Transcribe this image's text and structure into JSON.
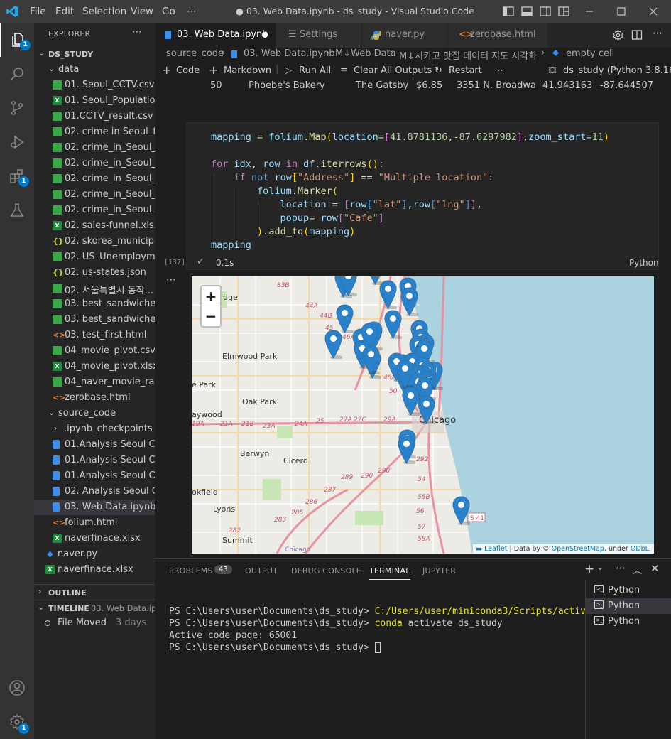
{
  "titlebar": {
    "menus": [
      "File",
      "Edit",
      "Selection",
      "View",
      "Go",
      "⋯"
    ],
    "title": "● 03. Web Data.ipynb - ds_study - Visual Studio Code"
  },
  "activity": {
    "explorer_badge": "1",
    "extensions_badge": "1",
    "settings_badge": "1"
  },
  "sidebar": {
    "header": "EXPLORER",
    "root": "DS_STUDY",
    "data_folder": "data",
    "data_files": [
      {
        "name": "01. Seoul_CCTV.csv",
        "type": "csv"
      },
      {
        "name": "01. Seoul_Populatio...",
        "type": "xlsx"
      },
      {
        "name": "01.CCTV_result.csv",
        "type": "csv"
      },
      {
        "name": "02. crime in Seoul_fi...",
        "type": "csv"
      },
      {
        "name": "02. crime_in_Seoul_1...",
        "type": "csv"
      },
      {
        "name": "02. crime_in_Seoul_fi...",
        "type": "csv"
      },
      {
        "name": "02. crime_in_Seoul_l...",
        "type": "csv"
      },
      {
        "name": "02. crime_in_Seoul_r...",
        "type": "csv"
      },
      {
        "name": "02. crime_in_Seoul.csv",
        "type": "csv"
      },
      {
        "name": "02. sales-funnel.xlsx",
        "type": "xlsx"
      },
      {
        "name": "02. skorea_municipa...",
        "type": "json"
      },
      {
        "name": "02. US_Unemploym...",
        "type": "csv"
      },
      {
        "name": "02. us-states.json",
        "type": "json"
      },
      {
        "name": "02. 서울특별시 동작...",
        "type": "csv"
      },
      {
        "name": "03. best_sandwiches...",
        "type": "csv"
      },
      {
        "name": "03. best_sandwiches...",
        "type": "csv"
      },
      {
        "name": "03. test_first.html",
        "type": "html"
      },
      {
        "name": "04_movie_pivot.csv",
        "type": "csv"
      },
      {
        "name": "04_movie_pivot.xlsx",
        "type": "xlsx"
      },
      {
        "name": "04_naver_movie_raw...",
        "type": "csv"
      },
      {
        "name": "zerobase.html",
        "type": "html"
      }
    ],
    "source_folder": "source_code",
    "source_files": [
      {
        "name": ".ipynb_checkpoints",
        "type": "folder"
      },
      {
        "name": "01.Analysis Seoul CC...",
        "type": "nb"
      },
      {
        "name": "01.Analysis Seoul CC...",
        "type": "nb"
      },
      {
        "name": "01.Analysis Seoul CC...",
        "type": "nb"
      },
      {
        "name": "02. Analysis Seoul Cr...",
        "type": "nb"
      },
      {
        "name": "03. Web Data.ipynb",
        "type": "nb"
      },
      {
        "name": "folium.html",
        "type": "html"
      },
      {
        "name": "naverfinace.xlsx",
        "type": "xlsx"
      }
    ],
    "root_files": [
      {
        "name": "naver.py",
        "type": "py"
      },
      {
        "name": "naverfinace.xlsx",
        "type": "xlsx"
      }
    ],
    "outline": "OUTLINE",
    "timeline": "TIMELINE",
    "timeline_file": "03. Web Data.ipy...",
    "timeline_event": "File Moved",
    "timeline_time": "3 days"
  },
  "tabs": [
    {
      "label": "03. Web Data.ipynb",
      "active": true
    },
    {
      "label": "Settings",
      "active": false
    },
    {
      "label": "naver.py",
      "active": false
    },
    {
      "label": "zerobase.html",
      "active": false
    }
  ],
  "breadcrumb": [
    "source_code",
    "03. Web Data.ipynb",
    "M↓Web Data",
    "M↓시카고 맛집 데이터 지도 시각화",
    "empty cell"
  ],
  "toolbar": {
    "code": "Code",
    "markdown": "Markdown",
    "run_all": "Run All",
    "clear": "Clear All Outputs",
    "restart": "Restart",
    "more": "⋯",
    "kernel": "ds_study (Python 3.8.16)"
  },
  "df_row": {
    "index": "50",
    "cafe": "Phoebe's Bakery",
    "sandwich": "The Gatsby",
    "price": "$6.85",
    "address": "3351 N. Broadwa",
    "lat": "41.943163",
    "lng": "-87.644507"
  },
  "cell": {
    "exec_count": "[137]",
    "status": "0.1s",
    "language": "Python"
  },
  "map": {
    "zoom_in": "+",
    "zoom_out": "−",
    "attribution_leaflet": "Leaflet",
    "attribution_mid": " | Data by © ",
    "attribution_osm": "OpenStreetMap",
    "attribution_end": ", under ",
    "attribution_odbl": "ODbL.",
    "labels": {
      "elmwood": "Elmwood Park",
      "oakpark": "Oak Park",
      "berwyn": "Berwyn",
      "cicero": "Cicero",
      "lyons": "Lyons",
      "summit": "Summit",
      "chicago": "Chicago",
      "park": "e Park",
      "haywood": "aywood",
      "brookfield": "okfield",
      "edge": "dge"
    },
    "colors": {
      "marker": "#2a81cb",
      "water": "#aad3df",
      "land": "#ecebe6"
    }
  },
  "panel": {
    "tabs": [
      "PROBLEMS",
      "OUTPUT",
      "DEBUG CONSOLE",
      "TERMINAL",
      "JUPYTER"
    ],
    "problems_count": "43",
    "terminal": {
      "prompt": "PS C:\\Users\\user\\Documents\\ds_study>",
      "cmd1": "C:/Users/user/miniconda3/Scripts/activate",
      "cmd2_a": "conda",
      "cmd2_b": " activate ds_study",
      "line3": "Active code page: 65001"
    },
    "terminal_list": [
      "Python",
      "Python",
      "Python"
    ]
  }
}
